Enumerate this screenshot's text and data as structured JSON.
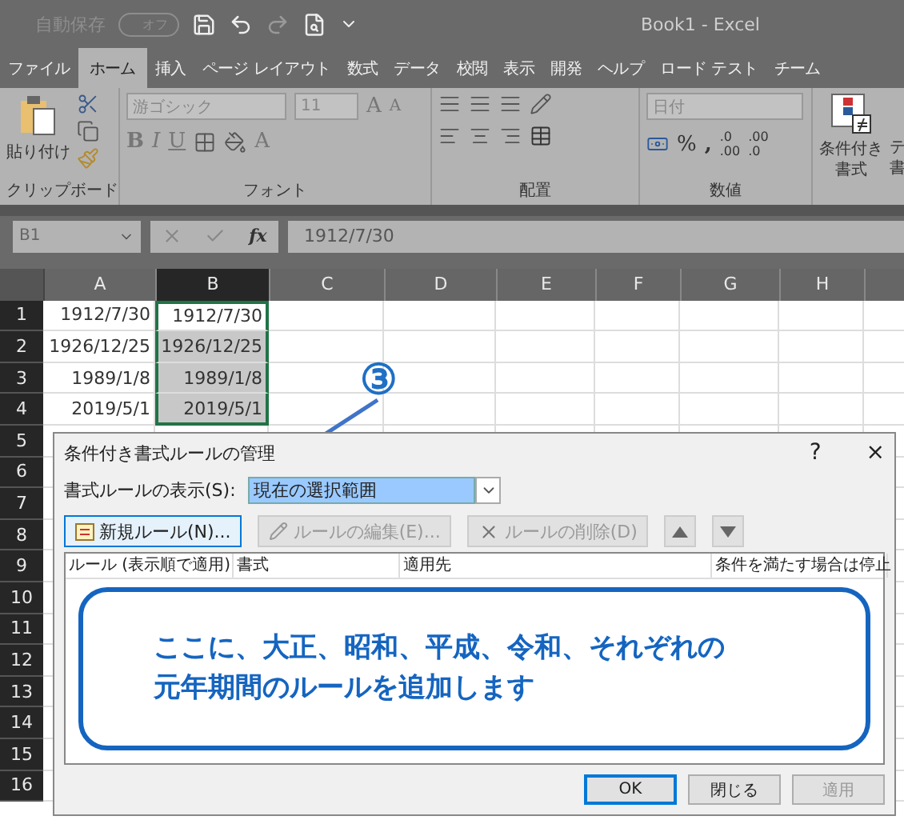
{
  "quick_access": {
    "autosave_label": "自動保存",
    "autosave_state": "オフ",
    "autosave_on": false
  },
  "window_title": "Book1  -  Excel",
  "tabs": [
    {
      "label": "ファイル",
      "selected": false
    },
    {
      "label": "ホーム",
      "selected": true
    },
    {
      "label": "挿入",
      "selected": false
    },
    {
      "label": "ページ レイアウト",
      "selected": false
    },
    {
      "label": "数式",
      "selected": false
    },
    {
      "label": "データ",
      "selected": false
    },
    {
      "label": "校閲",
      "selected": false
    },
    {
      "label": "表示",
      "selected": false
    },
    {
      "label": "開発",
      "selected": false
    },
    {
      "label": "ヘルプ",
      "selected": false
    },
    {
      "label": "ロード テスト",
      "selected": false
    },
    {
      "label": "チーム",
      "selected": false
    }
  ],
  "ribbon": {
    "clipboard": {
      "paste": "貼り付け",
      "group": "クリップボード"
    },
    "font": {
      "name": "游ゴシック",
      "size": "11",
      "grow": "A",
      "shrink": "A",
      "styles": [
        "B",
        "I",
        "U"
      ],
      "font_color": "A",
      "group": "フォント"
    },
    "alignment": {
      "group": "配置"
    },
    "number": {
      "format": "日付",
      "percent": "%",
      "comma": ",",
      "increase_decimal": [
        ".0",
        ".00"
      ],
      "decrease_decimal": [
        ".00",
        ".0"
      ],
      "group": "数値"
    },
    "styles": {
      "conditional": [
        "条件付き",
        "書式"
      ],
      "next_cut": [
        "テ",
        "書"
      ]
    }
  },
  "formula_bar": {
    "name_box": "B1",
    "fx": "fx",
    "formula": "1912/7/30"
  },
  "grid": {
    "columns": [
      {
        "label": "A",
        "selected": false
      },
      {
        "label": "B",
        "selected": true
      },
      {
        "label": "C",
        "selected": false
      },
      {
        "label": "D",
        "selected": false
      },
      {
        "label": "E",
        "selected": false
      },
      {
        "label": "F",
        "selected": false
      },
      {
        "label": "G",
        "selected": false
      },
      {
        "label": "H",
        "selected": false
      }
    ],
    "rows": [
      {
        "number": "1",
        "cells": [
          {
            "text": "1912/7/30",
            "selected": false
          },
          {
            "text": "1912/7/30",
            "selected": false
          }
        ]
      },
      {
        "number": "2",
        "cells": [
          {
            "text": "1926/12/25",
            "selected": false
          },
          {
            "text": "1926/12/25",
            "selected": true
          }
        ]
      },
      {
        "number": "3",
        "cells": [
          {
            "text": "1989/1/8",
            "selected": false
          },
          {
            "text": "1989/1/8",
            "selected": true
          }
        ]
      },
      {
        "number": "4",
        "cells": [
          {
            "text": "2019/5/1",
            "selected": false
          },
          {
            "text": "2019/5/1",
            "selected": true
          }
        ]
      },
      {
        "number": "5",
        "cells": []
      },
      {
        "number": "6",
        "cells": []
      },
      {
        "number": "7",
        "cells": []
      },
      {
        "number": "8",
        "cells": []
      },
      {
        "number": "9",
        "cells": []
      },
      {
        "number": "10",
        "cells": []
      },
      {
        "number": "11",
        "cells": []
      },
      {
        "number": "12",
        "cells": []
      },
      {
        "number": "13",
        "cells": []
      },
      {
        "number": "14",
        "cells": []
      },
      {
        "number": "15",
        "cells": []
      },
      {
        "number": "16",
        "cells": []
      }
    ]
  },
  "step_marker": "③",
  "dialog": {
    "title": "条件付き書式ルールの管理",
    "help": "?",
    "close": "×",
    "show_label": "書式ルールの表示(S):",
    "scope": "現在の選択範囲",
    "toolbar": [
      {
        "label": "新規ルール(N)...",
        "kind": "new",
        "disabled": false,
        "focused": true
      },
      {
        "label": "ルールの編集(E)...",
        "kind": "edit",
        "disabled": true,
        "focused": false
      },
      {
        "label": "ルールの削除(D)",
        "kind": "delete",
        "disabled": true,
        "focused": false
      }
    ],
    "columns": [
      "ルール (表示順で適用)",
      "書式",
      "適用先",
      "条件を満たす場合は停止"
    ],
    "callout": [
      "ここに、大正、昭和、平成、令和、それぞれの",
      "元年期間のルールを追加します"
    ],
    "buttons": [
      {
        "label": "OK",
        "default": true,
        "disabled": false
      },
      {
        "label": "閉じる",
        "default": false,
        "disabled": false
      },
      {
        "label": "適用",
        "default": false,
        "disabled": true
      }
    ]
  }
}
